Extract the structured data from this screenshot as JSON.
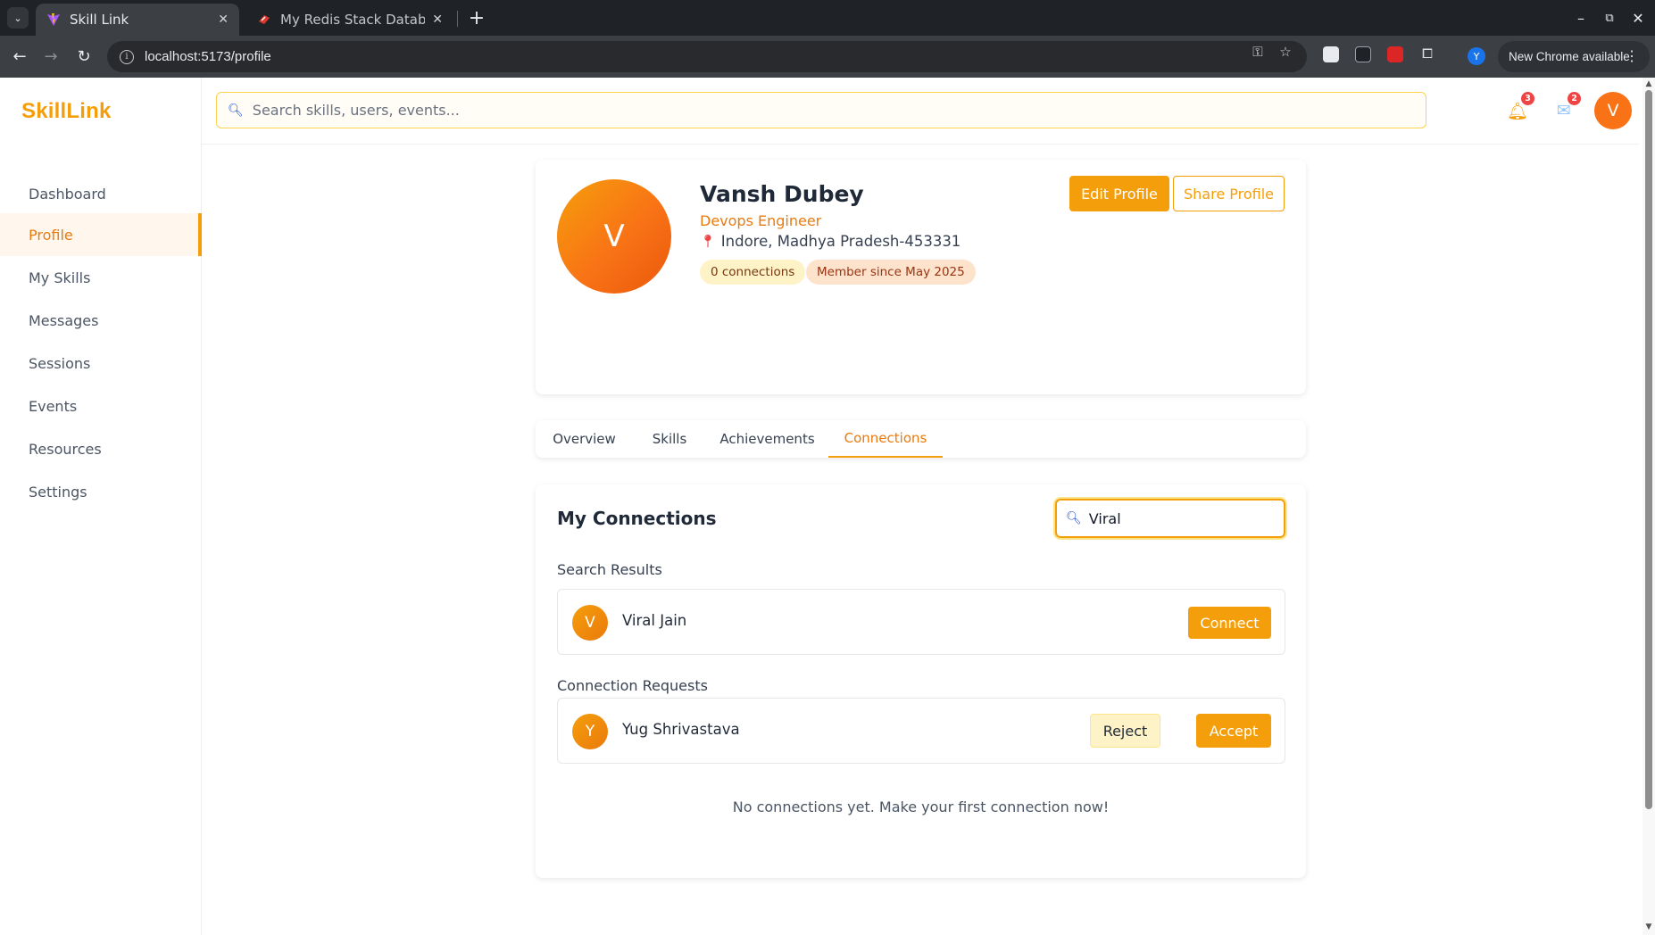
{
  "browser": {
    "tabs": [
      {
        "title": "Skill Link",
        "active": true
      },
      {
        "title": "My Redis Stack Database",
        "active": false
      }
    ],
    "url": "localhost:5173/profile",
    "update_label": "New Chrome available",
    "profile_initial": "Y"
  },
  "app": {
    "brand": "SkillLink",
    "search_placeholder": "Search skills, users, events...",
    "notifications_count": "3",
    "messages_count": "2",
    "user_initial": "V",
    "accent_color": "#f59e0b"
  },
  "sidebar": {
    "items": [
      {
        "label": "Dashboard",
        "active": false
      },
      {
        "label": "Profile",
        "active": true
      },
      {
        "label": "My Skills",
        "active": false
      },
      {
        "label": "Messages",
        "active": false
      },
      {
        "label": "Sessions",
        "active": false
      },
      {
        "label": "Events",
        "active": false
      },
      {
        "label": "Resources",
        "active": false
      },
      {
        "label": "Settings",
        "active": false
      }
    ]
  },
  "profile": {
    "initial": "V",
    "name": "Vansh Dubey",
    "role": "Devops Engineer",
    "location": "Indore, Madhya Pradesh-453331",
    "connections_chip": "0 connections",
    "member_chip": "Member since May 2025",
    "edit_label": "Edit Profile",
    "share_label": "Share Profile"
  },
  "tabs": [
    {
      "label": "Overview",
      "active": false
    },
    {
      "label": "Skills",
      "active": false
    },
    {
      "label": "Achievements",
      "active": false
    },
    {
      "label": "Connections",
      "active": true
    }
  ],
  "connections": {
    "title": "My Connections",
    "search_value": "Viral",
    "search_results_label": "Search Results",
    "search_results": [
      {
        "initial": "V",
        "name": "Viral Jain",
        "action": "Connect"
      }
    ],
    "requests_label": "Connection Requests",
    "requests": [
      {
        "initial": "Y",
        "name": "Yug Shrivastava",
        "reject": "Reject",
        "accept": "Accept"
      }
    ],
    "empty_message": "No connections yet. Make your first connection now!"
  }
}
